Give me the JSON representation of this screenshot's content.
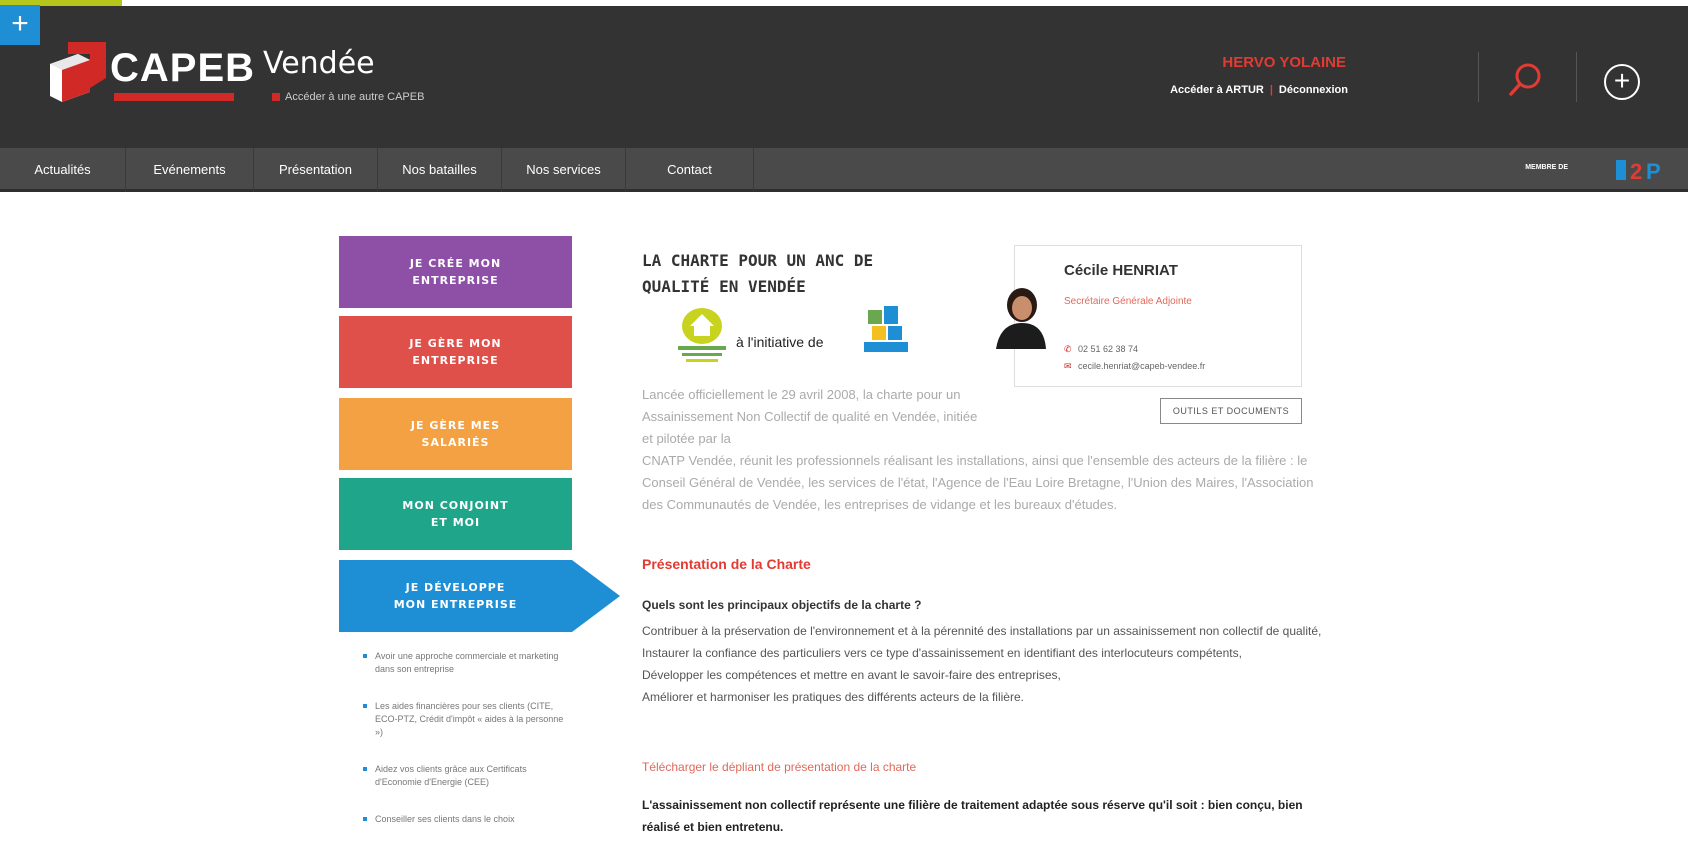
{
  "header": {
    "logo_word": "CAPEB",
    "region_title": "Vendée",
    "other_capeb_link": "Accéder à une autre CAPEB",
    "user_name": "HERVO YOLAINE",
    "artur_link": "Accéder à ARTUR",
    "logout_link": "Déconnexion",
    "plus_tab": "+",
    "add_symbol": "+"
  },
  "nav": {
    "items": [
      {
        "label": "Actualités"
      },
      {
        "label": "Evénements"
      },
      {
        "label": "Présentation"
      },
      {
        "label": "Nos batailles"
      },
      {
        "label": "Nos services"
      },
      {
        "label": "Contact"
      }
    ],
    "member_label": "MEMBRE DE"
  },
  "sidebar": {
    "tiles": [
      {
        "label": "JE CRÉE MON\nENTREPRISE",
        "color": "#8e4fa7"
      },
      {
        "label": "JE GÈRE MON\nENTREPRISE",
        "color": "#e0504a"
      },
      {
        "label": "JE GÈRE MES\nSALARIÉS",
        "color": "#f3a143"
      },
      {
        "label": "MON CONJOINT\nET MOI",
        "color": "#1fa68a"
      },
      {
        "label": "JE DÉVELOPPE\nMON ENTREPRISE",
        "color": "#1e8fd4"
      }
    ],
    "sub_items": [
      "Avoir une approche commerciale et marketing dans son entreprise",
      "Les aides financières pour ses clients (CITE, ECO-PTZ, Crédit d'impôt « aides à la personne »)",
      "Aidez vos clients grâce aux Certificats d'Economie d'Energie (CEE)",
      "Conseiller ses clients dans le choix"
    ]
  },
  "article": {
    "title_line1": "LA CHARTE POUR UN ANC DE",
    "title_line2": "QUALITÉ EN VENDÉE",
    "initiative": "à l'initiative de",
    "intro_narrow": "Lancée officiellement le 29 avril 2008, la charte pour un Assainissement Non Collectif de qualité en Vendée, initiée et pilotée par la",
    "intro_wide": "CNATP Vendée, réunit les professionnels réalisant les installations, ainsi que l'ensemble des acteurs de la filière : le Conseil Général de Vendée, les services de l'état, l'Agence de l'Eau Loire Bretagne, l'Union des Maires, l'Association des Communautés de Vendée, les entreprises de vidange et les bureaux d'études.",
    "section_title": "Présentation de la Charte",
    "question": "Quels sont les principaux objectifs de la charte ?",
    "objectives": [
      "Contribuer à la préservation de l'environnement et à la pérennité des installations par un assainissement non collectif de qualité,",
      "Instaurer la confiance des particuliers vers ce type d'assainissement en identifiant des interlocuteurs compétents,",
      "Développer les compétences et mettre en avant le savoir-faire des entreprises,",
      "Améliorer et harmoniser les pratiques des différents acteurs de la filière."
    ],
    "download_link": "Télécharger le dépliant de présentation de la charte",
    "conclusion": "L'assainissement non collectif représente une filière de traitement adaptée sous réserve qu'il soit : bien conçu, bien réalisé et bien entretenu."
  },
  "contact": {
    "name": "Cécile HENRIAT",
    "role": "Secrétaire Générale Adjointe",
    "phone": "02 51 62 38 74",
    "email": "cecile.henriat@capeb-vendee.fr",
    "tools_button": "OUTILS ET DOCUMENTS"
  },
  "colors": {
    "header_bg": "#333333",
    "nav_bg": "#4a4a4a",
    "accent_red": "#e23b33",
    "accent_blue": "#1e8fd4",
    "lime": "#b5c71a"
  },
  "icons": {
    "search": "search-icon",
    "plus_circle": "plus-circle-icon",
    "phone": "phone-icon",
    "email": "envelope-icon"
  }
}
